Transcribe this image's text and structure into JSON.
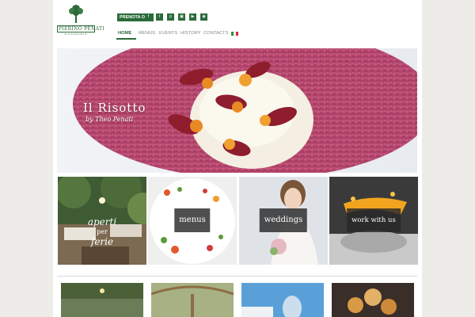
{
  "header": {
    "logo_name": "PIERINO PENATI",
    "logo_sub": "RISTORANTE",
    "booking_button": "PRENOTA ORA",
    "social_icons": [
      "facebook-icon",
      "twitter-icon",
      "pinterest-icon",
      "instagram-icon",
      "youtube-icon",
      "tripadvisor-icon"
    ],
    "social_glyphs": [
      "f",
      "t",
      "p",
      "▣",
      "▶",
      "◉"
    ],
    "nav": [
      {
        "label": "HOME",
        "active": true
      },
      {
        "label": "MENUS",
        "active": false
      },
      {
        "label": "EVENTS",
        "active": false
      },
      {
        "label": "HISTORY",
        "active": false
      },
      {
        "label": "CONTACTS",
        "active": false
      }
    ],
    "language_flag": "italian-flag-icon"
  },
  "hero": {
    "title": "Il Risotto",
    "subtitle": "by Theo Penati"
  },
  "tiles": [
    {
      "line1": "aperti",
      "line2": "per",
      "line3": "ferie"
    },
    {
      "label": "menus"
    },
    {
      "label": "weddings"
    },
    {
      "label": "work with us"
    }
  ],
  "colors": {
    "brand_green": "#2b6b3a",
    "page_background": "#eeece8",
    "label_box": "#2e2e2e"
  }
}
